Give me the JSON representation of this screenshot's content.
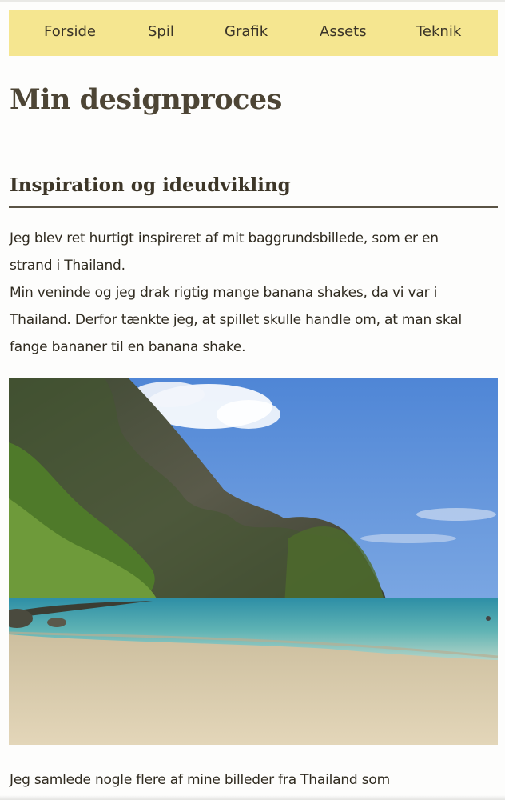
{
  "nav": {
    "items": [
      {
        "label": "Forside"
      },
      {
        "label": "Spil"
      },
      {
        "label": "Grafik"
      },
      {
        "label": "Assets"
      },
      {
        "label": "Teknik"
      }
    ]
  },
  "page": {
    "title": "Min designproces"
  },
  "section": {
    "heading": "Inspiration og ideudvikling",
    "paragraph1_lines": [
      "Jeg blev ret hurtigt inspireret af mit baggrundsbillede, som er en",
      "strand i Thailand.",
      "Min veninde og jeg drak rigtig mange banana shakes, da vi var i",
      "Thailand. Derfor tænkte jeg, at spillet skulle handle om, at man skal",
      "fange bananer til en banana shake."
    ],
    "paragraph2_lines": [
      "Jeg samlede nogle flere af mine billeder fra Thailand som"
    ]
  },
  "colors": {
    "nav_background": "#f5e690",
    "heading_text": "#4d4535",
    "body_text": "#2f2a1f",
    "rule": "#5a5344"
  }
}
